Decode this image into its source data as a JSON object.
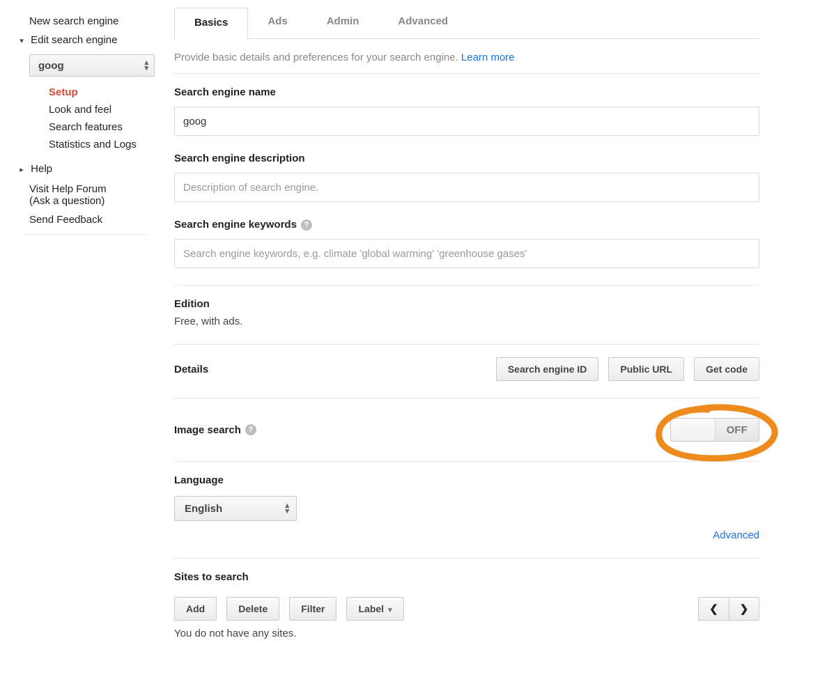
{
  "sidebar": {
    "new_engine": "New search engine",
    "edit_engine": "Edit search engine",
    "selected_engine": "goog",
    "sub_items": [
      {
        "label": "Setup",
        "active": true
      },
      {
        "label": "Look and feel",
        "active": false
      },
      {
        "label": "Search features",
        "active": false
      },
      {
        "label": "Statistics and Logs",
        "active": false
      }
    ],
    "help": "Help",
    "visit_forum_line1": "Visit Help Forum",
    "visit_forum_line2": "(Ask a question)",
    "send_feedback": "Send Feedback"
  },
  "tabs": [
    {
      "label": "Basics",
      "active": true
    },
    {
      "label": "Ads",
      "active": false
    },
    {
      "label": "Admin",
      "active": false
    },
    {
      "label": "Advanced",
      "active": false
    }
  ],
  "intro": {
    "text": "Provide basic details and preferences for your search engine. ",
    "link": "Learn more"
  },
  "fields": {
    "name_label": "Search engine name",
    "name_value": "goog",
    "desc_label": "Search engine description",
    "desc_placeholder": "Description of search engine.",
    "keywords_label": "Search engine keywords",
    "keywords_placeholder": "Search engine keywords, e.g. climate 'global warming' 'greenhouse gases'",
    "edition_label": "Edition",
    "edition_value": "Free, with ads.",
    "details_label": "Details",
    "btn_search_id": "Search engine ID",
    "btn_public_url": "Public URL",
    "btn_get_code": "Get code",
    "image_search_label": "Image search",
    "toggle_off": "OFF",
    "language_label": "Language",
    "language_value": "English",
    "advanced_link": "Advanced",
    "sites_label": "Sites to search",
    "btn_add": "Add",
    "btn_delete": "Delete",
    "btn_filter": "Filter",
    "btn_label": "Label",
    "empty_sites": "You do not have any sites."
  }
}
